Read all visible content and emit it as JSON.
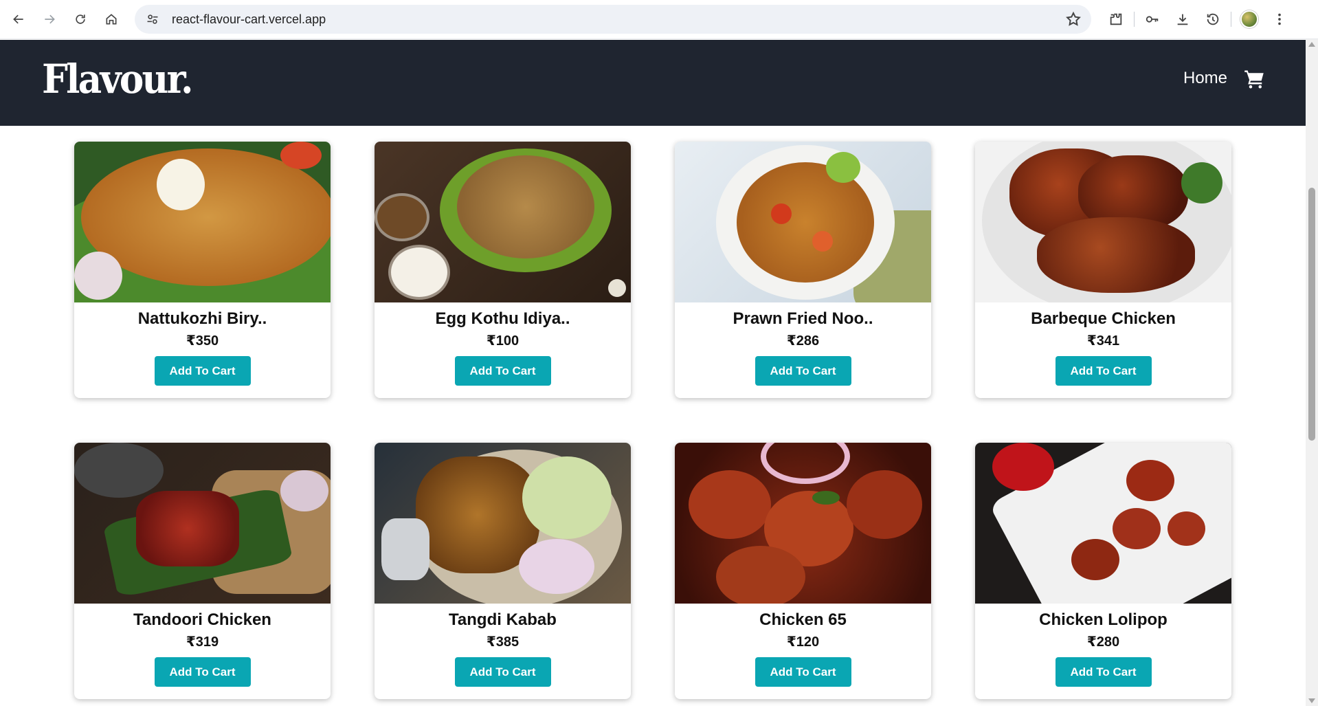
{
  "browser": {
    "url": "react-flavour-cart.vercel.app",
    "icons": [
      "back-icon",
      "forward-icon",
      "reload-icon",
      "home-icon",
      "site-info-icon",
      "star-icon",
      "extensions-icon",
      "password-key-icon",
      "download-icon",
      "history-icon",
      "profile-avatar",
      "menu-icon"
    ]
  },
  "header": {
    "logo": "Flavour.",
    "nav_home": "Home",
    "cart_icon": "cart-icon"
  },
  "products": [
    {
      "name": "Nattukozhi Biry..",
      "price": "₹350",
      "button": "Add To Cart"
    },
    {
      "name": "Egg Kothu Idiya..",
      "price": "₹100",
      "button": "Add To Cart"
    },
    {
      "name": "Prawn Fried Noo..",
      "price": "₹286",
      "button": "Add To Cart"
    },
    {
      "name": "Barbeque Chicken",
      "price": "₹341",
      "button": "Add To Cart"
    },
    {
      "name": "Tandoori Chicken",
      "price": "₹319",
      "button": "Add To Cart"
    },
    {
      "name": "Tangdi Kabab",
      "price": "₹385",
      "button": "Add To Cart"
    },
    {
      "name": "Chicken 65",
      "price": "₹120",
      "button": "Add To Cart"
    },
    {
      "name": "Chicken Lolipop",
      "price": "₹280",
      "button": "Add To Cart"
    }
  ],
  "colors": {
    "header_bg": "#1f2530",
    "button_bg": "#0aa6b3"
  }
}
